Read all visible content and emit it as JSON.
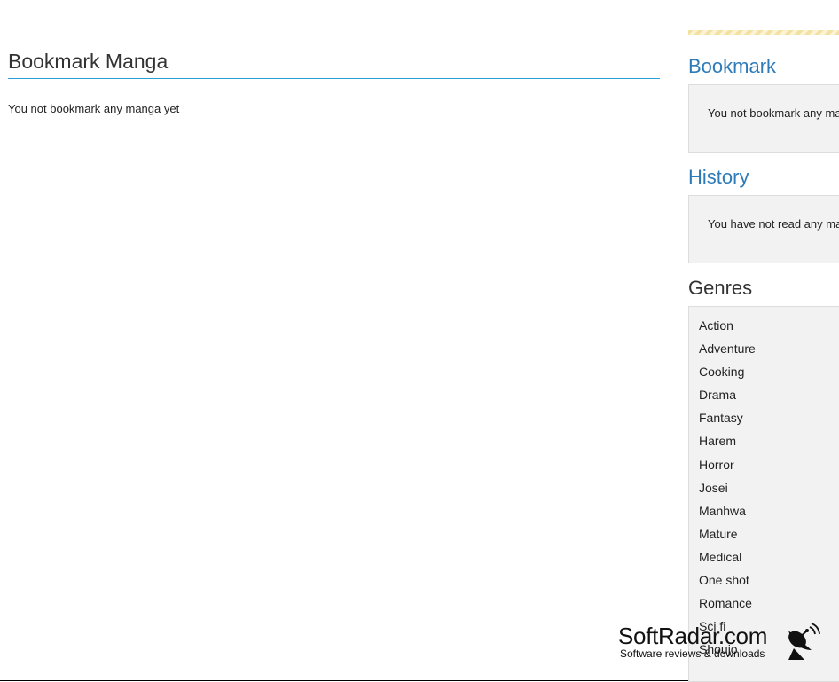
{
  "main": {
    "title": "Bookmark Manga",
    "empty_message": "You not bookmark any manga yet"
  },
  "sidebar": {
    "bookmark": {
      "heading": "Bookmark",
      "message": "You not bookmark any ma"
    },
    "history": {
      "heading": "History",
      "message": "You have not read any ma"
    },
    "genres": {
      "heading": "Genres",
      "items": [
        "Action",
        "Adventure",
        "Cooking",
        "Drama",
        "Fantasy",
        "Harem",
        "Horror",
        "Josei",
        "Manhwa",
        "Mature",
        "Medical",
        "One shot",
        "Romance",
        "Sci fi",
        "Shoujo"
      ]
    }
  },
  "watermark": {
    "title": "SoftRadar.com",
    "subtitle": "Software reviews & downloads",
    "icon": "satellite-dish-icon"
  },
  "colors": {
    "accent_blue": "#2f7bb8",
    "underline_blue": "#2a9fd6",
    "box_bg": "#f2f2f2"
  }
}
